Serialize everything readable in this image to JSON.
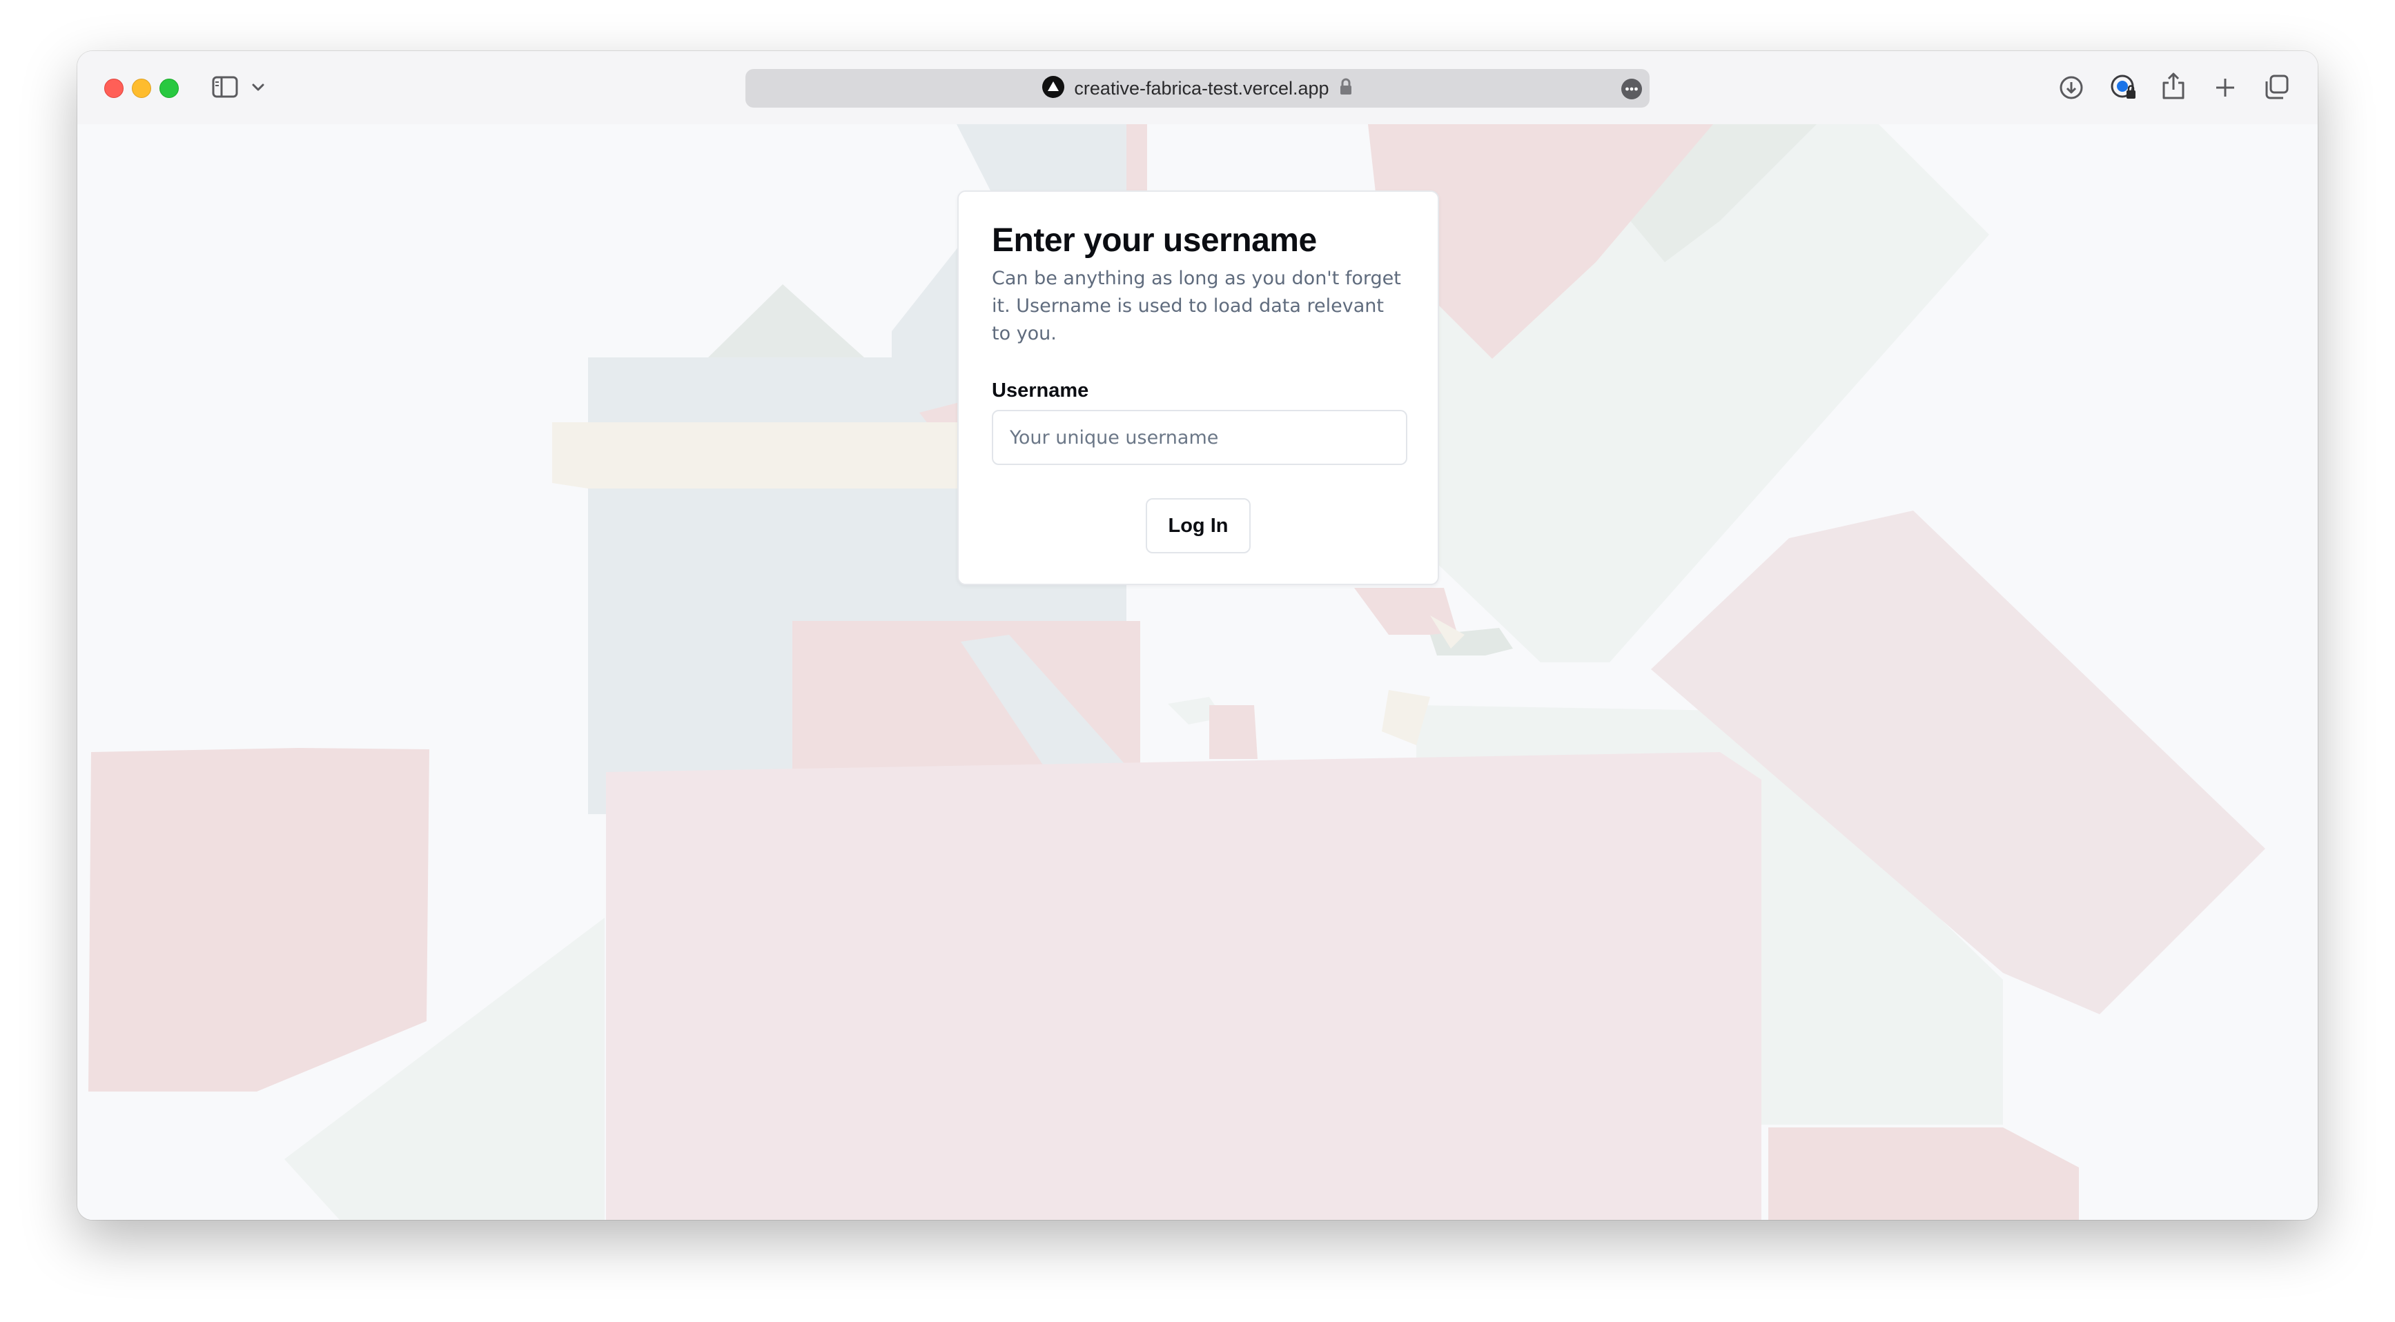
{
  "browser": {
    "url": "creative-fabrica-test.vercel.app",
    "icons": {
      "sidebar": "sidebar-toggle-icon",
      "chevron": "chevron-down-icon",
      "site": "vercel-triangle-icon",
      "lock": "lock-icon",
      "more": "more-options-icon",
      "download": "download-icon",
      "password": "password-manager-icon",
      "share": "share-icon",
      "new_tab": "plus-icon",
      "tabs": "tab-overview-icon"
    }
  },
  "login": {
    "title": "Enter your username",
    "description": "Can be anything as long as you don't forget it. Username is used to load data relevant to you.",
    "username_label": "Username",
    "username_placeholder": "Your unique username",
    "username_value": "",
    "login_button": "Log In"
  },
  "colors": {
    "background": "#f8f9fb",
    "shape_pink": "#f0dfe0",
    "shape_blue": "#e6ebee",
    "shape_mint": "#eff3f2",
    "shape_cream": "#f4f1ea",
    "text_primary": "#0b0d12",
    "text_muted": "#5f6b7d"
  }
}
